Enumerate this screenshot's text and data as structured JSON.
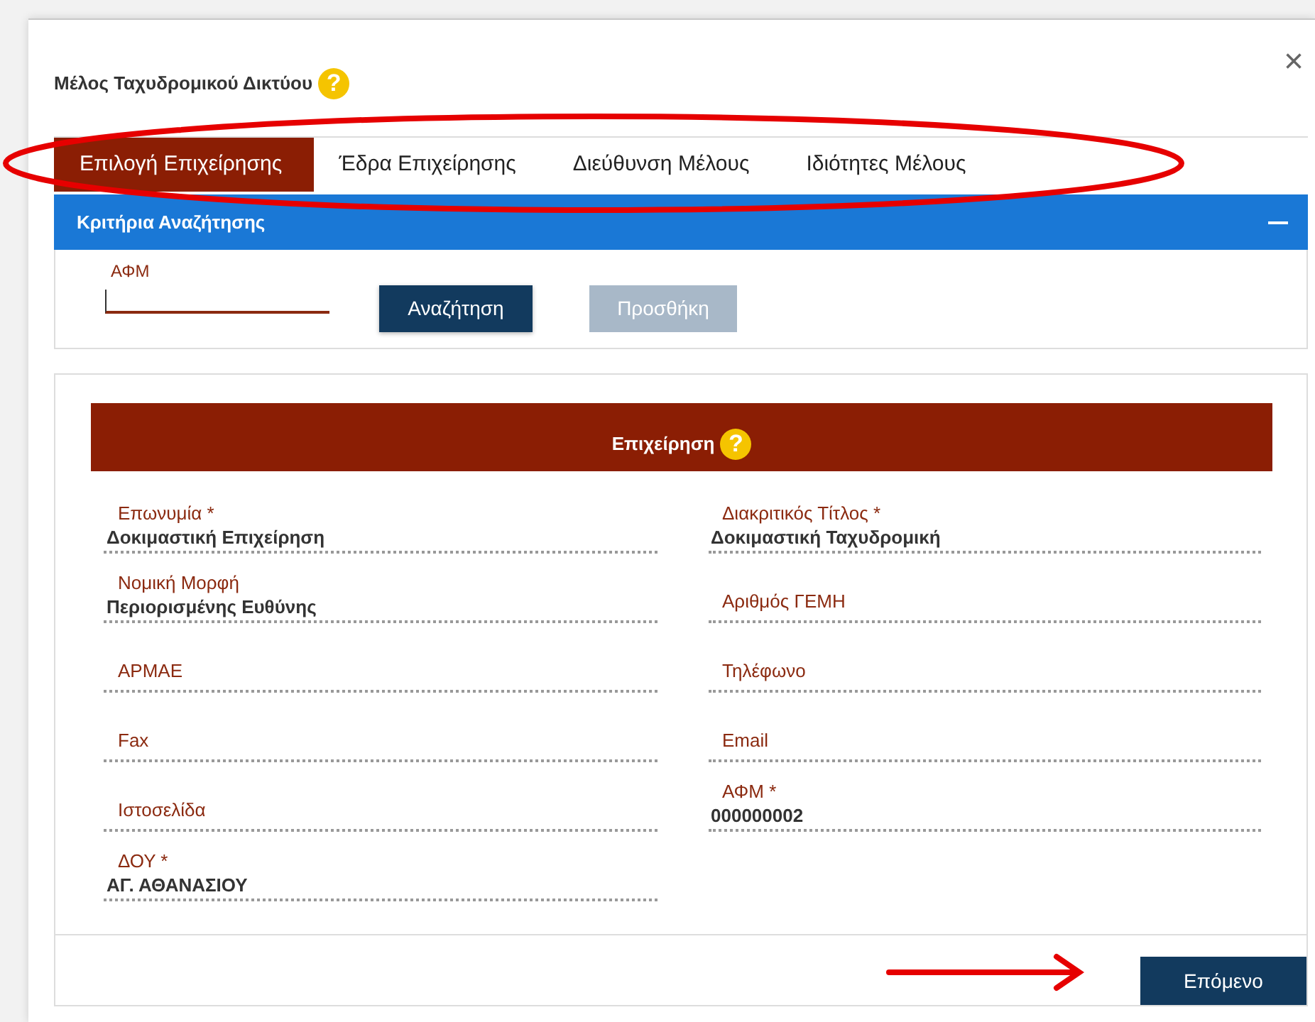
{
  "dialog": {
    "title": "Μέλος Ταχυδρομικού Δικτύου",
    "help": "?",
    "close": "×"
  },
  "tabs": [
    {
      "label": "Επιλογή Επιχείρησης",
      "selected": true
    },
    {
      "label": "Έδρα Επιχείρησης",
      "selected": false
    },
    {
      "label": "Διεύθυνση Μέλους",
      "selected": false
    },
    {
      "label": "Ιδιότητες Μέλους",
      "selected": false
    }
  ],
  "search_panel": {
    "title": "Κριτήρια Αναζήτησης",
    "expanded": true,
    "field": {
      "label": "ΑΦΜ"
    },
    "buttons": [
      {
        "label": "Αναζήτηση",
        "disabled": false
      },
      {
        "label": "Προσθήκη",
        "disabled": true
      }
    ]
  },
  "business": {
    "title": "Επιχείρηση",
    "help": "?",
    "left_fields": [
      {
        "label": "Επωνυμία *",
        "value": "Δοκιμαστική Επιχείρηση"
      },
      {
        "label": "Νομική Μορφή",
        "value": "Περιορισμένης Ευθύνης"
      },
      {
        "label": "ΑΡΜΑΕ"
      },
      {
        "label": "Fax"
      },
      {
        "label": "Ιστοσελίδα"
      },
      {
        "label": "ΔΟΥ *",
        "value": "ΑΓ. ΑΘΑΝΑΣΙΟΥ"
      }
    ],
    "right_fields": [
      {
        "label": "Διακριτικός Τίτλος *",
        "value": "Δοκιμαστική Ταχυδρομική"
      },
      {
        "label": "Αριθμός ΓΕΜΗ"
      },
      {
        "label": "Τηλέφωνο"
      },
      {
        "label": "Email"
      },
      {
        "label": "ΑΦΜ *",
        "value": "000000002"
      }
    ]
  },
  "footer": {
    "next_button": "Επόμενο"
  }
}
